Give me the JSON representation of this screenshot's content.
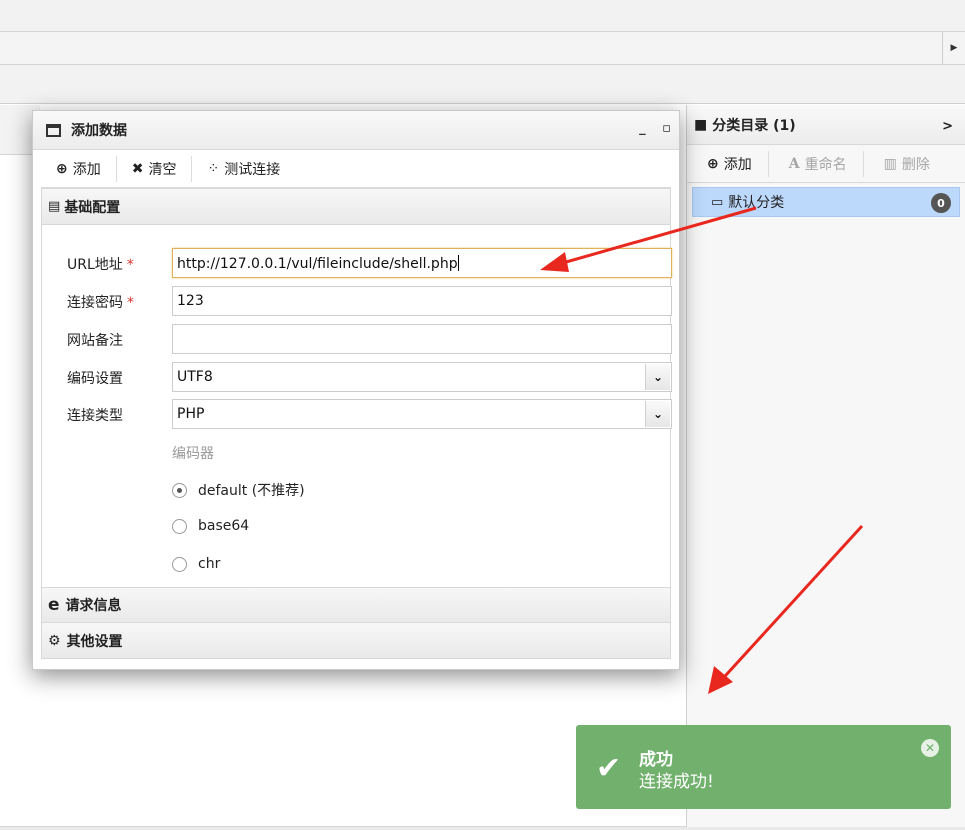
{
  "app": {
    "tab_scroll_icon": "caret-right-icon"
  },
  "dialog": {
    "title": "添加数据",
    "toolbar": {
      "add_label": "添加",
      "clear_label": "清空",
      "test_label": "测试连接"
    },
    "section_basic": "基础配置",
    "fields": {
      "url_label": "URL地址",
      "url_value": "http://127.0.0.1/vul/fileinclude/shell.php",
      "password_label": "连接密码",
      "password_value": "123",
      "note_label": "网站备注",
      "note_value": "",
      "encoding_label": "编码设置",
      "encoding_value": "UTF8",
      "type_label": "连接类型",
      "type_value": "PHP",
      "required_mark": "*"
    },
    "encoder": {
      "label": "编码器",
      "options": [
        "default (不推荐)",
        "base64",
        "chr"
      ],
      "selected": "default (不推荐)"
    },
    "section_request": "请求信息",
    "section_other": "其他设置"
  },
  "category_panel": {
    "title": "分类目录 (1)",
    "toolbar": {
      "add_label": "添加",
      "rename_label": "重命名",
      "delete_label": "删除"
    },
    "items": [
      {
        "label": "默认分类",
        "count": "0"
      }
    ]
  },
  "toast": {
    "title": "成功",
    "message": "连接成功!"
  },
  "colors": {
    "toast_bg": "#71b06d",
    "selection_bg": "#bcd8fb",
    "annotation_arrow": "#e8281e"
  }
}
